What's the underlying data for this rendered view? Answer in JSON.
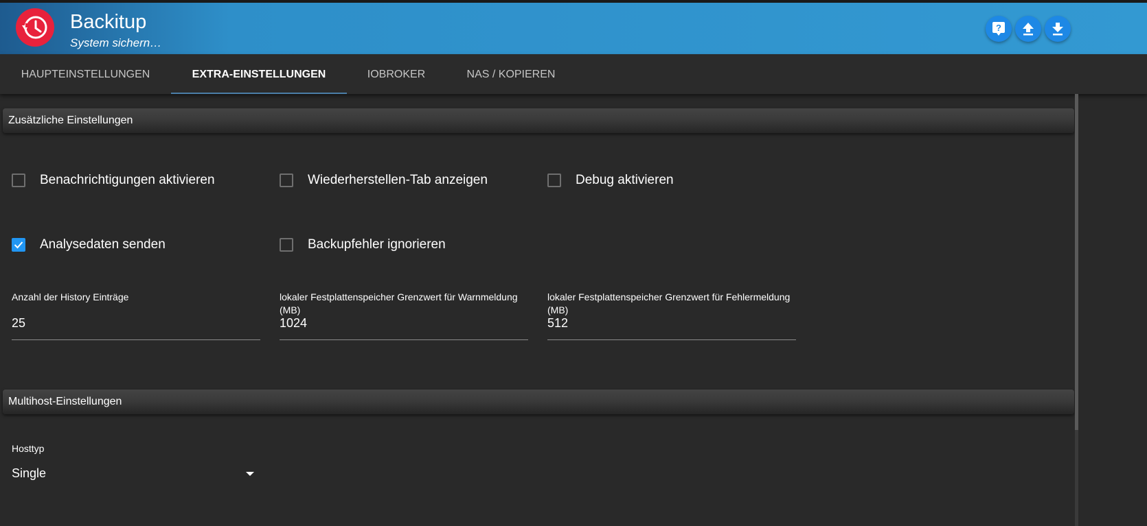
{
  "header": {
    "title": "Backitup",
    "subtitle": "System sichern…",
    "buttons": {
      "help": "help-icon",
      "upload": "upload-icon",
      "download": "download-icon"
    },
    "colors": {
      "accent": "#1e88e5",
      "logo": "#e8223c"
    }
  },
  "tabs": [
    {
      "label": "HAUPTEINSTELLUNGEN",
      "active": false
    },
    {
      "label": "EXTRA-EINSTELLUNGEN",
      "active": true
    },
    {
      "label": "IOBROKER",
      "active": false
    },
    {
      "label": "NAS / KOPIEREN",
      "active": false
    }
  ],
  "extra": {
    "section_title": "Zusätzliche Einstellungen",
    "checkboxes": [
      {
        "label": "Benachrichtigungen aktivieren",
        "checked": false
      },
      {
        "label": "Wiederherstellen-Tab anzeigen",
        "checked": false
      },
      {
        "label": "Debug aktivieren",
        "checked": false
      },
      {
        "label": "Analysedaten senden",
        "checked": true
      },
      {
        "label": "Backupfehler ignorieren",
        "checked": false
      }
    ],
    "fields": [
      {
        "label": "Anzahl der History Einträge",
        "value": "25"
      },
      {
        "label": "lokaler Festplattenspeicher Grenzwert für Warnmeldung (MB)",
        "value": "1024"
      },
      {
        "label": "lokaler Festplattenspeicher Grenzwert für Fehlermeldung (MB)",
        "value": "512"
      }
    ]
  },
  "multihost": {
    "section_title": "Multihost-Einstellungen",
    "hosttype_label": "Hosttyp",
    "hosttype_value": "Single"
  }
}
